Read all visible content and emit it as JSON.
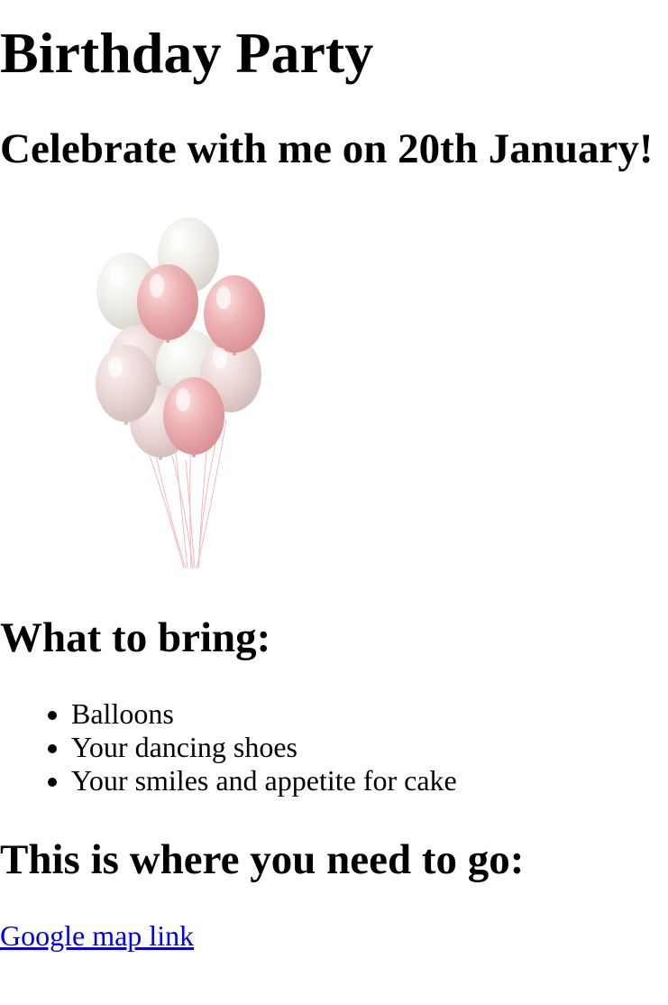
{
  "page": {
    "title": "Birthday Party",
    "subtitle": "Celebrate with me on 20th January!",
    "bring_heading": "What to bring:",
    "bring_items": [
      "Balloons",
      "Your dancing shoes",
      "Your smiles and appetite for cake"
    ],
    "where_heading": "This is where you need to go:",
    "map_link_label": "Google map link"
  },
  "colors": {
    "link": "#0000ee",
    "text": "#000000",
    "balloon_pink": "#eaaeb0",
    "balloon_cream": "#ecebe5"
  }
}
